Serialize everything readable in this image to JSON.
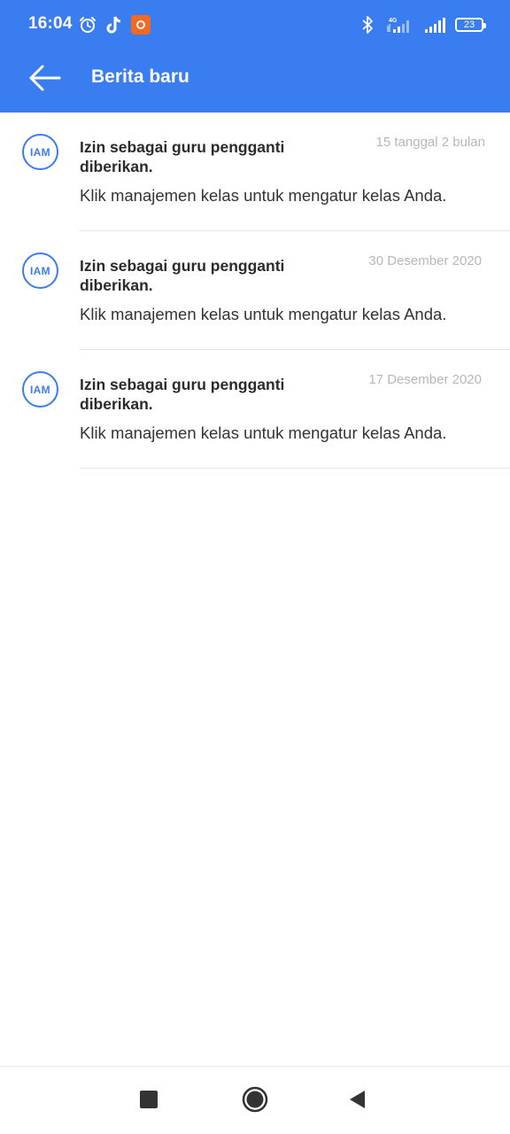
{
  "status_bar": {
    "time": "16:04",
    "left_icons": [
      "alarm-icon",
      "tiktok-icon",
      "screen-recorder-icon"
    ],
    "right_icons": [
      "bluetooth-icon",
      "signal-4g-icon",
      "signal-icon",
      "battery-icon"
    ],
    "network_label": "4G",
    "battery_level": "23"
  },
  "app_bar": {
    "title": "Berita baru",
    "back_icon": "arrow-left-icon",
    "background_color": "#3a7df0"
  },
  "news": [
    {
      "avatar": "IAM",
      "title": "Izin sebagai guru pengganti diberikan.",
      "date": "15 tanggal 2 bulan",
      "body": "Klik manajemen kelas untuk mengatur kelas Anda."
    },
    {
      "avatar": "IAM",
      "title": "Izin sebagai guru pengganti diberikan.",
      "date": "30 Desember 2020",
      "body": "Klik manajemen kelas untuk mengatur kelas Anda."
    },
    {
      "avatar": "IAM",
      "title": "Izin sebagai guru pengganti diberikan.",
      "date": "17 Desember 2020",
      "body": "Klik manajemen kelas untuk mengatur kelas Anda."
    }
  ],
  "nav_bar": {
    "buttons": [
      "recent-apps-icon",
      "home-icon",
      "back-triangle-icon"
    ]
  }
}
